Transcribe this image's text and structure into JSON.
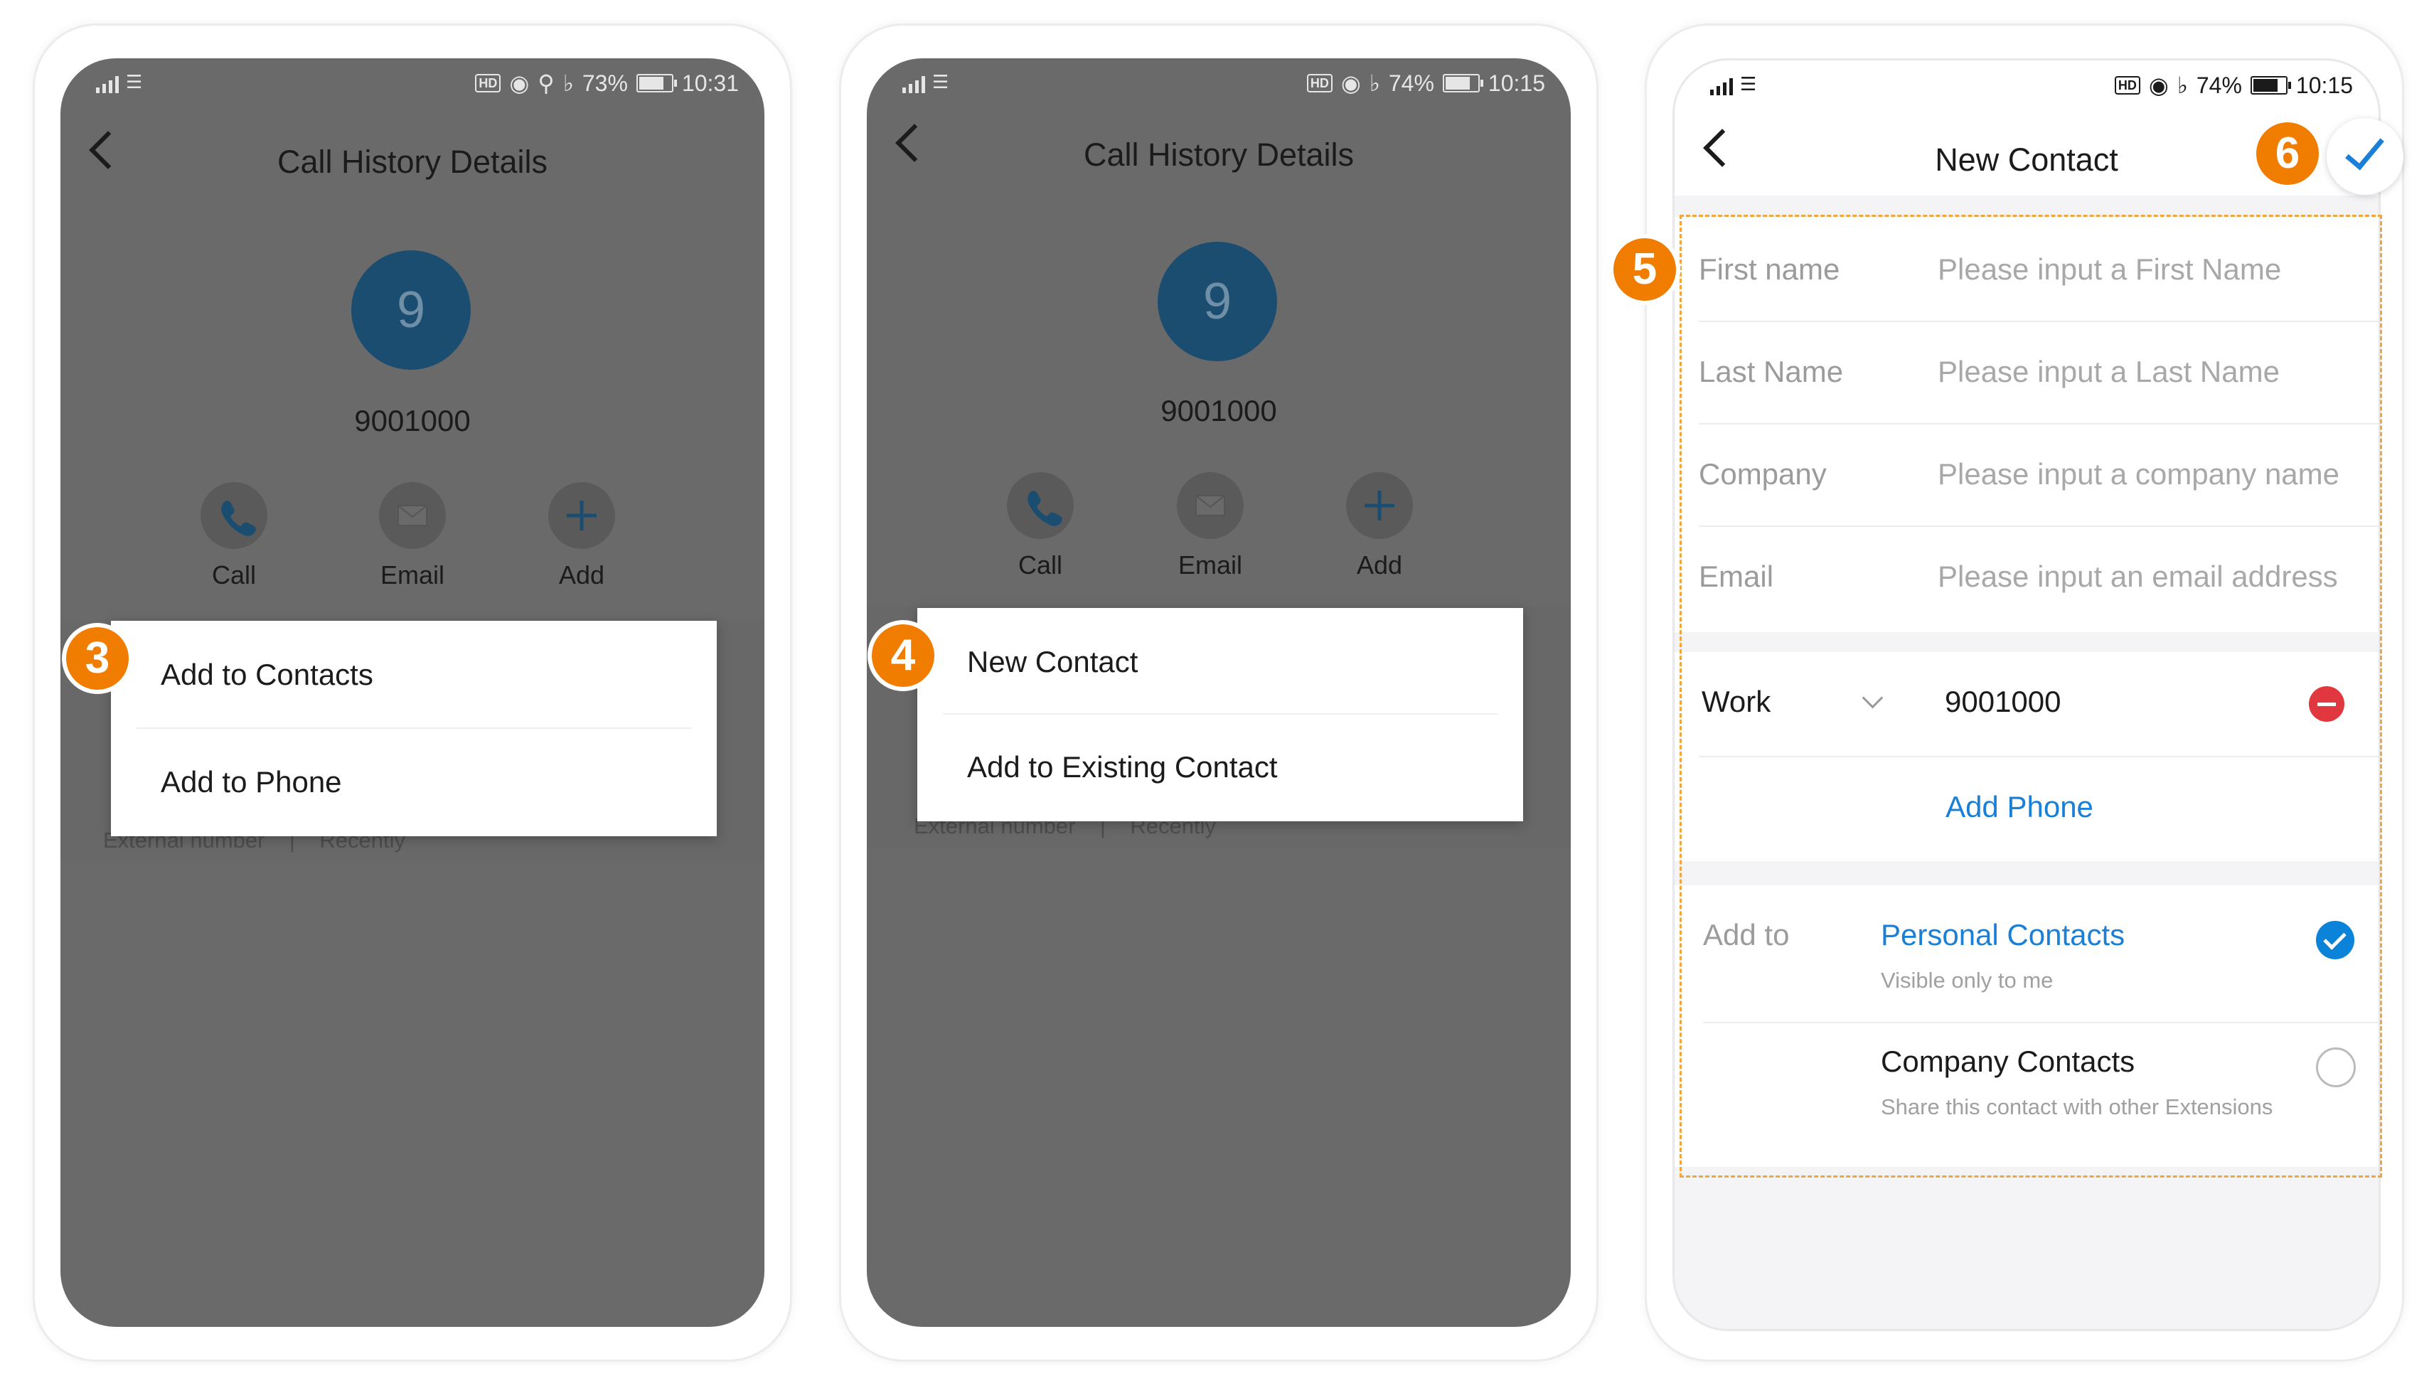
{
  "status_bars": [
    {
      "battery": "73%",
      "time": "10:31",
      "battery_level": 0.73
    },
    {
      "battery": "74%",
      "time": "10:15",
      "battery_level": 0.74
    },
    {
      "battery": "74%",
      "time": "10:15",
      "battery_level": 0.74
    }
  ],
  "call_history": {
    "title": "Call History Details",
    "avatar_letter": "9",
    "number": "9001000",
    "actions": {
      "call": "Call",
      "email": "Email",
      "add": "Add"
    },
    "ext_label": "External number",
    "ext_sep": "|",
    "ext_time": "Recently"
  },
  "popup1": {
    "item1": "Add to Contacts",
    "item2": "Add to Phone"
  },
  "popup2": {
    "item1": "New Contact",
    "item2": "Add to Existing Contact"
  },
  "badges": {
    "b3": "3",
    "b4": "4",
    "b5": "5",
    "b6": "6"
  },
  "new_contact": {
    "title": "New Contact",
    "fields": [
      {
        "label": "First name",
        "placeholder": "Please input a First Name"
      },
      {
        "label": "Last Name",
        "placeholder": "Please input a Last Name"
      },
      {
        "label": "Company",
        "placeholder": "Please input a company name"
      },
      {
        "label": "Email",
        "placeholder": "Please input an email address"
      }
    ],
    "phone_type": "Work",
    "phone_value": "9001000",
    "add_phone": "Add Phone",
    "add_to_label": "Add to",
    "personal_contacts": "Personal Contacts",
    "personal_sub": "Visible only to me",
    "company_contacts": "Company Contacts",
    "company_sub": "Share this contact with other Extensions"
  },
  "colors": {
    "accent": "#1a7fd6",
    "badge": "#f07d00",
    "avatar": "#1a4d70",
    "danger": "#e0383e"
  }
}
